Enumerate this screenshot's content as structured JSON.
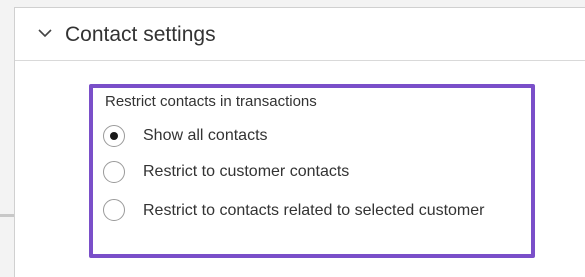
{
  "section": {
    "title": "Contact settings",
    "expanded": true,
    "toggle_icon": "chevron-down-icon"
  },
  "restrict_contacts": {
    "label": "Restrict contacts in transactions",
    "options": [
      {
        "label": "Show all contacts",
        "selected": true
      },
      {
        "label": "Restrict to customer contacts",
        "selected": false
      },
      {
        "label": "Restrict to contacts related to selected customer",
        "selected": false
      }
    ]
  },
  "colors": {
    "highlight_border": "#7a4fc9",
    "text": "#333333"
  }
}
